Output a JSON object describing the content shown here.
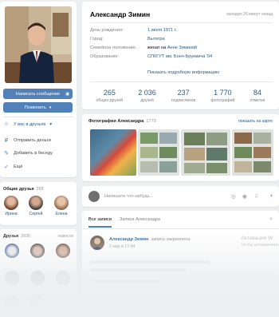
{
  "profile": {
    "name": "Александр Зимин",
    "last_seen": "заходил 26 минут назад",
    "rows": [
      {
        "key": "День рождения:",
        "value": "1 июля 1971 г."
      },
      {
        "key": "Город:",
        "value": "Вытегра"
      },
      {
        "key": "Семейное положение:",
        "value_prefix": "женат на ",
        "value": "Анне Зиминой"
      },
      {
        "key": "Образование:",
        "value": "СПбГУТ им. Бонч-Бруевича '04"
      }
    ],
    "more_info": "Показать подробную информацию",
    "counters": [
      {
        "n": "265",
        "l": "общих друзей"
      },
      {
        "n": "2 036",
        "l": "друзей"
      },
      {
        "n": "237",
        "l": "подписчиков"
      },
      {
        "n": "1 770",
        "l": "фотографий"
      },
      {
        "n": "84",
        "l": "отметки"
      }
    ]
  },
  "left": {
    "message_button": "Написать сообщение",
    "more_button": "Позвонить",
    "menu": [
      {
        "icon": "friend-check-icon",
        "label": "У вас в друзьях"
      },
      {
        "icon": "money-icon",
        "label": "Отправить деньги"
      },
      {
        "icon": "add-chat-icon",
        "label": "Добавить в беседу"
      },
      {
        "icon": "check-icon",
        "label": "Ещё"
      }
    ],
    "mutual_friends": {
      "title": "Общие друзья",
      "count": "265",
      "names": [
        "Ирина",
        "Сергей",
        "Елена"
      ]
    },
    "friends": {
      "title": "Друзья",
      "count": "2036",
      "link": "новости"
    }
  },
  "photos": {
    "title": "Фотографии Александра",
    "count": "1770",
    "map_link": "показать на карте"
  },
  "composer": {
    "placeholder": "Напишите что-нибудь..."
  },
  "wall": {
    "tabs": [
      "Все записи",
      "Записи Александра"
    ],
    "post_author": "Александр Зимин",
    "post_note": "запись закреплена",
    "post_date": "2 мар в 17:44",
    "activate_line1": "Активация W",
    "activate_line2": "Чтобы активировать"
  },
  "colors": {
    "accent": "#5181b8",
    "link": "#2a5885",
    "background": "#edeef0"
  }
}
